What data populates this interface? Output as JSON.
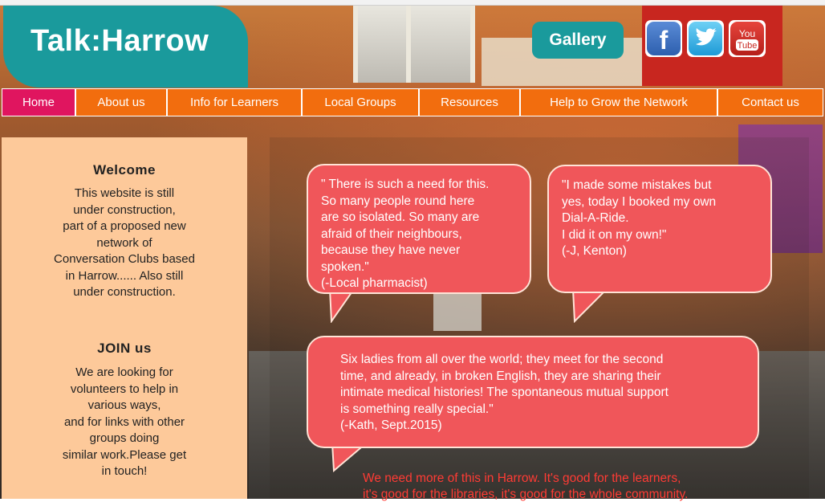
{
  "site": {
    "title": "Talk:Harrow"
  },
  "header": {
    "gallery_label": "Gallery",
    "social": [
      "facebook-icon",
      "twitter-icon",
      "youtube-icon"
    ],
    "youtube_text": [
      "You",
      "Tube"
    ],
    "facebook_text": "f"
  },
  "nav": {
    "items": [
      {
        "label": "Home"
      },
      {
        "label": "About us"
      },
      {
        "label": "Info for Learners"
      },
      {
        "label": "Local Groups"
      },
      {
        "label": "Resources"
      },
      {
        "label": "Help to Grow the Network"
      },
      {
        "label": "Contact us"
      }
    ],
    "active": "Home"
  },
  "sidebar": {
    "welcome_title": "Welcome",
    "welcome_text": "This website is still\nunder construction,\npart of a proposed new\nnetwork of\nConversation Clubs based\nin Harrow...... Also still\nunder construction.",
    "join_title": "JOIN us",
    "join_text": "We are looking for\nvolunteers to help in\nvarious ways,\nand for links with other\ngroups doing\nsimilar work.Please get\nin touch!"
  },
  "quotes": [
    {
      "text": "\" There is such a need for this.\nSo many people round here\nare so isolated. So many are\nafraid of their neighbours,\nbecause they have never\nspoken.\"\n(-Local pharmacist)"
    },
    {
      "text": "\"I made some mistakes but\nyes, today I booked my own\nDial-A-Ride.\nI did it on my own!\"\n (-J, Kenton)"
    },
    {
      "text": "Six ladies from all over the world; they meet for the second\ntime, and already, in broken English, they are sharing their\nintimate medical histories! The spontaneous mutual support\nis something really special.\"\n(-Kath, Sept.2015)"
    }
  ],
  "footer_quote": "We need more of this in Harrow. It's good for the learners,\nit's good for the libraries, it's good for the whole community.",
  "colors": {
    "teal": "#1a9a9c",
    "nav_orange": "#f26d0e",
    "nav_active": "#e0155f",
    "sidebar": "#fdc99a",
    "bubble": "#f0565a"
  }
}
